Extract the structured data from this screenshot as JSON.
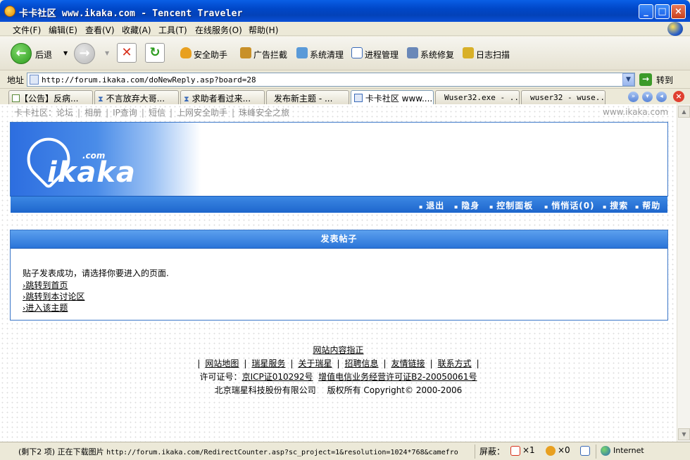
{
  "window": {
    "title": "卡卡社区 www.ikaka.com - Tencent Traveler",
    "minimize": "_",
    "maximize": "□",
    "close": "×"
  },
  "menu": {
    "items": [
      "文件(F)",
      "编辑(E)",
      "查看(V)",
      "收藏(A)",
      "工具(T)",
      "在线服务(O)",
      "帮助(H)"
    ]
  },
  "toolbar": {
    "back": "后退",
    "buttons": [
      "安全助手",
      "广告拦截",
      "系统清理",
      "进程管理",
      "系统修复",
      "日志扫描"
    ]
  },
  "address": {
    "label": "地址",
    "url": "http://forum.ikaka.com/doNewReply.asp?board=28",
    "go": "转到"
  },
  "tabs": [
    {
      "label": "【公告】反病..."
    },
    {
      "label": "不言放弃大哥..."
    },
    {
      "label": "求助者看过来..."
    },
    {
      "label": "发布新主题 - ..."
    },
    {
      "label": "卡卡社区 www...."
    },
    {
      "label": "Wuser32.exe - ..."
    },
    {
      "label": "wuser32 - wuse..."
    }
  ],
  "page": {
    "topnav": [
      "卡卡社区：论坛",
      "相册",
      "IP查询",
      "短信",
      "上网安全助手",
      "珠峰安全之旅"
    ],
    "siteurl": "www.ikaka.com",
    "logo": {
      "text": "ikaka",
      "suffix": ".com"
    },
    "nav": [
      "退出",
      "隐身",
      "控制面板",
      "悄悄话(0)",
      "搜索",
      "帮助"
    ],
    "panel": {
      "title": "发表帖子",
      "message": "贴子发表成功，请选择你要进入的页面.",
      "links": [
        "跳转到首页",
        "跳转到本讨论区",
        "进入该主题"
      ]
    },
    "footer": {
      "guide": "网站内容指正",
      "links": [
        "网站地图",
        "瑞星服务",
        "关于瑞星",
        "招聘信息",
        "友情链接",
        "联系方式"
      ],
      "license_label": "许可证号：",
      "icp": "京ICP证010292号",
      "license2": "增值电信业务经营许可证B2-20050061号",
      "copyright": "北京瑞星科技股份有限公司　 版权所有 Copyright© 2000-2006"
    }
  },
  "status": {
    "message": "(剩下2 项) 正在下载图片",
    "url": "http://forum.ikaka.com/RedirectCounter.asp?sc_project=1&resolution=1024*768&camefro",
    "screen_label": "屏蔽：",
    "popup_count": "×1",
    "ad_count": "×0",
    "zone": "Internet"
  }
}
